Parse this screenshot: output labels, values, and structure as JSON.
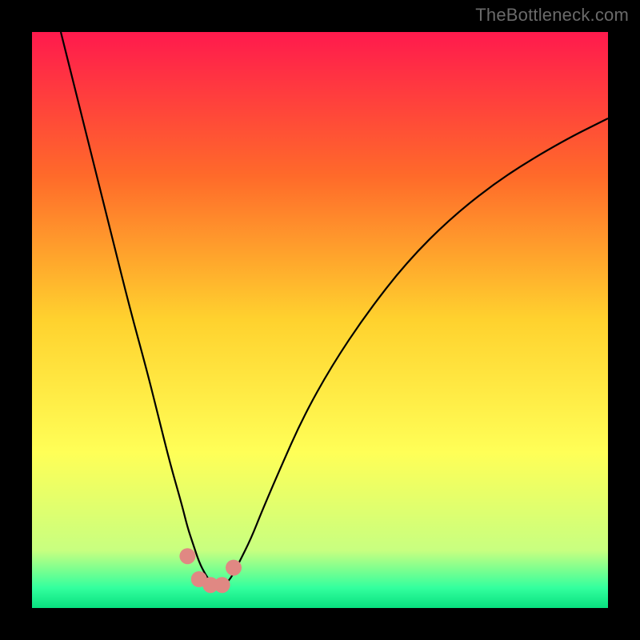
{
  "watermark": "TheBottleneck.com",
  "chart_data": {
    "type": "line",
    "title": "",
    "xlabel": "",
    "ylabel": "",
    "xlim": [
      0,
      100
    ],
    "ylim": [
      0,
      100
    ],
    "grid": false,
    "legend": false,
    "background_gradient_stops": [
      {
        "offset": 0.0,
        "color": "#ff1a4d"
      },
      {
        "offset": 0.25,
        "color": "#ff6a2a"
      },
      {
        "offset": 0.5,
        "color": "#ffd22e"
      },
      {
        "offset": 0.73,
        "color": "#ffff57"
      },
      {
        "offset": 0.9,
        "color": "#c8ff80"
      },
      {
        "offset": 0.965,
        "color": "#33ff9e"
      },
      {
        "offset": 1.0,
        "color": "#08e07f"
      }
    ],
    "series": [
      {
        "name": "curve",
        "color": "#000000",
        "x": [
          5,
          8,
          11,
          14,
          17,
          20,
          22,
          24,
          26,
          27,
          28,
          29,
          30,
          31,
          32,
          33,
          34,
          35,
          36,
          38,
          40,
          43,
          47,
          52,
          58,
          65,
          73,
          82,
          92,
          100
        ],
        "y": [
          100,
          88,
          76,
          64,
          52,
          41,
          33,
          25,
          18,
          14,
          11,
          8,
          6,
          4.5,
          4,
          4,
          4.5,
          6,
          8,
          12,
          17,
          24,
          33,
          42,
          51,
          60,
          68,
          75,
          81,
          85
        ]
      }
    ],
    "markers": {
      "color": "#e08883",
      "radius_px": 10,
      "points": [
        {
          "x": 27.0,
          "y": 9.0
        },
        {
          "x": 29.0,
          "y": 5.0
        },
        {
          "x": 31.0,
          "y": 4.0
        },
        {
          "x": 33.0,
          "y": 4.0
        },
        {
          "x": 35.0,
          "y": 7.0
        }
      ]
    }
  }
}
